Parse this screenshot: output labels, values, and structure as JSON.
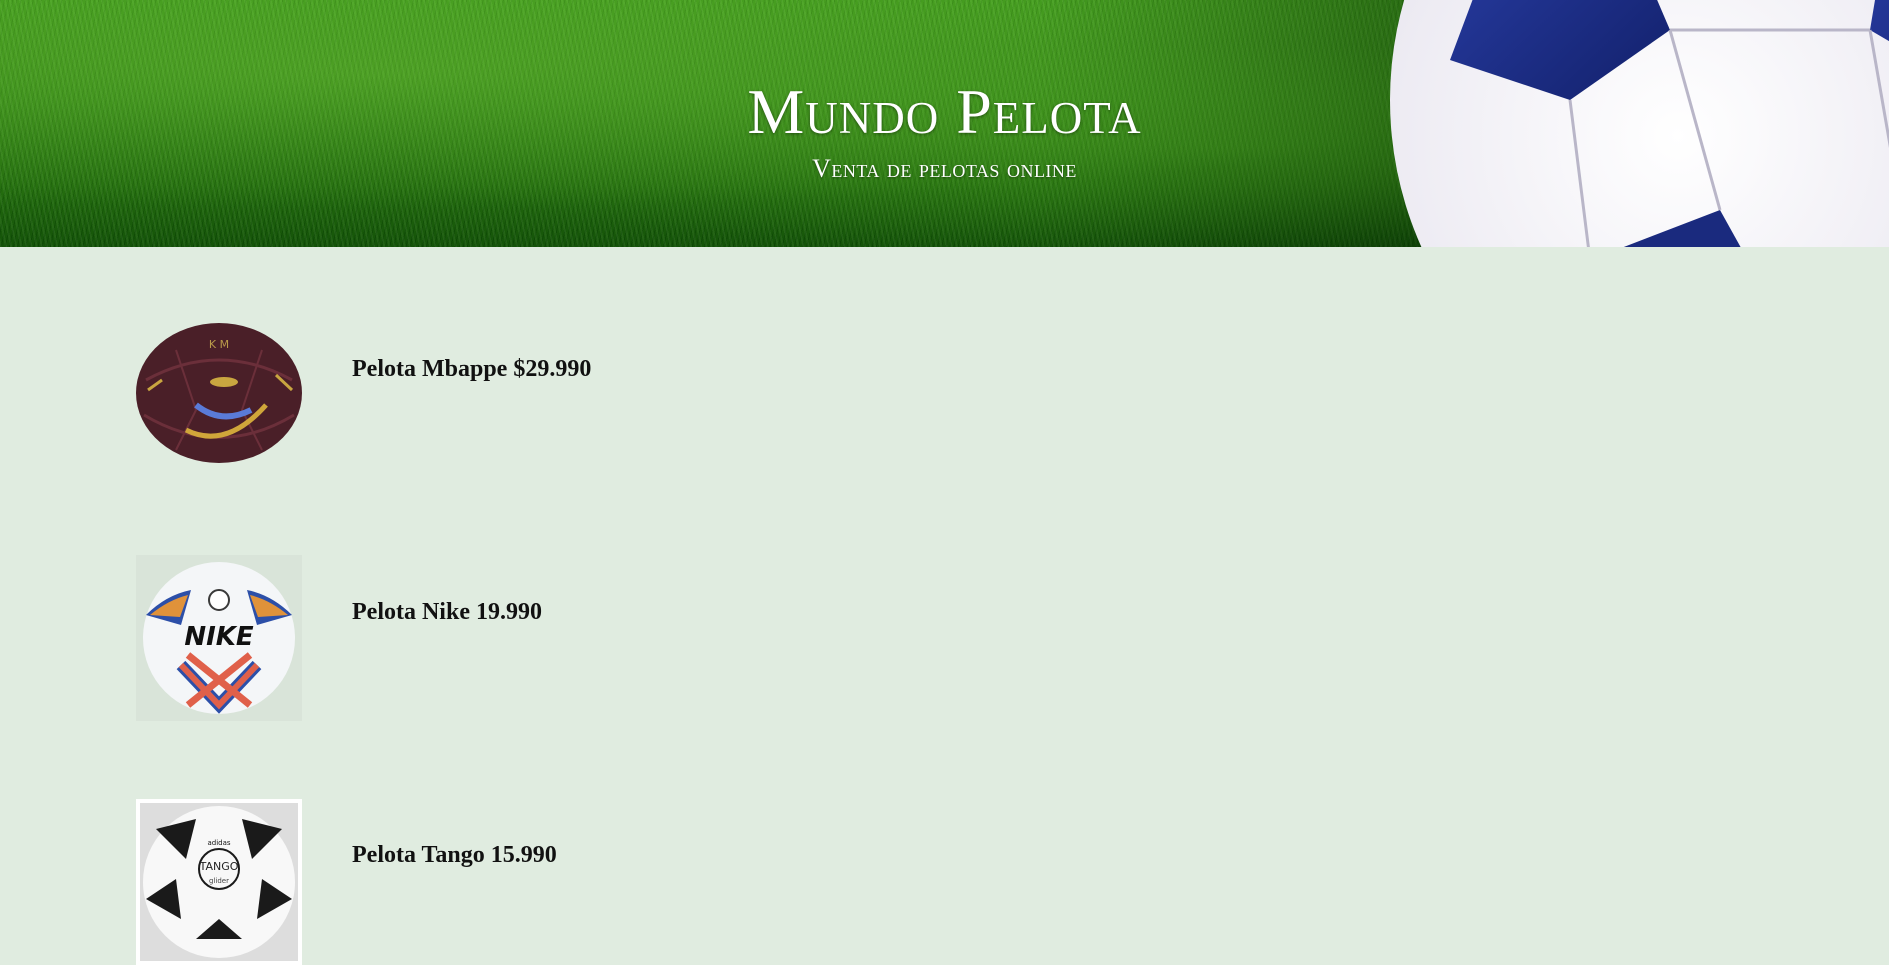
{
  "header": {
    "title": "Mundo Pelota",
    "subtitle": "Venta de pelotas online"
  },
  "products": [
    {
      "label": "Pelota Mbappe $29.990",
      "image": "maroon-soccer-ball-icon"
    },
    {
      "label": "Pelota Nike 19.990",
      "image": "nike-soccer-ball-icon"
    },
    {
      "label": "Pelota Tango 15.990",
      "image": "tango-soccer-ball-icon"
    }
  ],
  "colors": {
    "page_background": "#e0ece0",
    "grass": "#2f8414",
    "text": "#111111",
    "header_text": "#ffffff"
  }
}
